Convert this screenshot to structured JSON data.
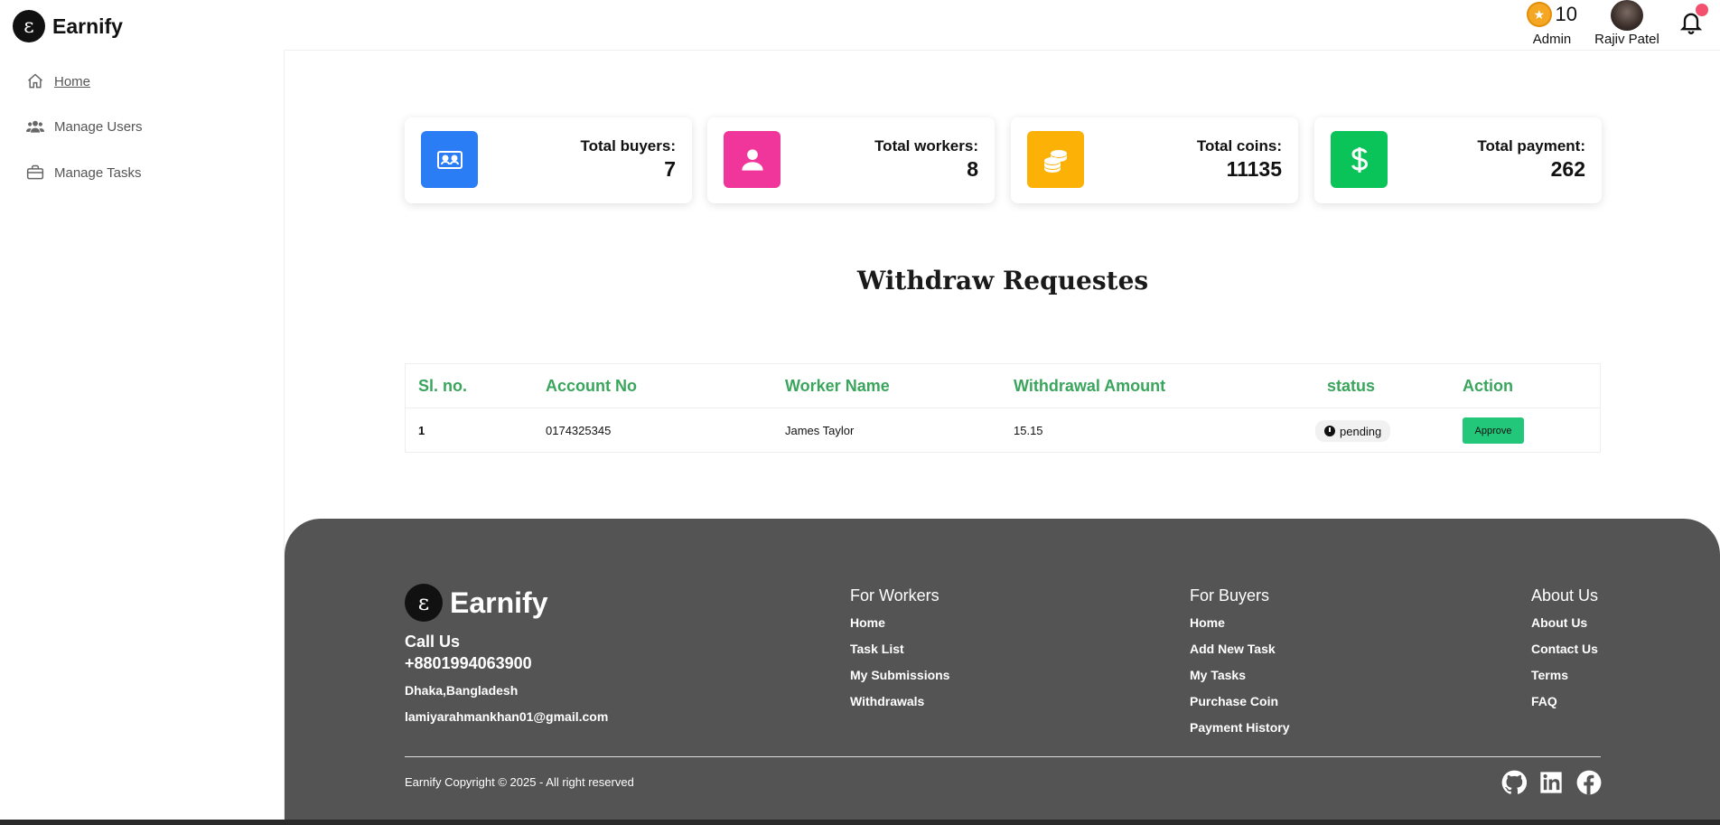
{
  "app": {
    "brand": "Earnify",
    "logo_glyph": "ɛ"
  },
  "header": {
    "coins": "10",
    "role": "Admin",
    "user_name": "Rajiv Patel",
    "notification_dot": true
  },
  "sidebar": {
    "items": [
      {
        "label": "Home",
        "icon": "home-icon",
        "active": true
      },
      {
        "label": "Manage Users",
        "icon": "users-icon",
        "active": false
      },
      {
        "label": "Manage Tasks",
        "icon": "briefcase-icon",
        "active": false
      }
    ]
  },
  "stats": [
    {
      "label": "Total buyers:",
      "value": "7",
      "icon": "id-card-icon",
      "color": "#2b7df6"
    },
    {
      "label": "Total workers:",
      "value": "8",
      "icon": "user-icon",
      "color": "#f0359b"
    },
    {
      "label": "Total coins:",
      "value": "11135",
      "icon": "coins-icon",
      "color": "#fbb105"
    },
    {
      "label": "Total payment:",
      "value": "262",
      "icon": "dollar-icon",
      "color": "#0ac459"
    }
  ],
  "withdraw": {
    "title": "Withdraw Requestes",
    "columns": [
      "Sl. no.",
      "Account No",
      "Worker Name",
      "Withdrawal Amount",
      "status",
      "Action"
    ],
    "rows": [
      {
        "sl": "1",
        "account": "0174325345",
        "worker": "James Taylor",
        "amount": "15.15",
        "status": "pending",
        "action": "Approve"
      }
    ]
  },
  "footer": {
    "brand": "Earnify",
    "call_us": "Call Us",
    "phone": "+8801994063900",
    "address": "Dhaka,Bangladesh",
    "email": "lamiyarahmankhan01@gmail.com",
    "workers": {
      "title": "For Workers",
      "links": [
        "Home",
        "Task List",
        "My Submissions",
        "Withdrawals"
      ]
    },
    "buyers": {
      "title": "For Buyers",
      "links": [
        "Home",
        "Add New Task",
        "My Tasks",
        "Purchase Coin",
        "Payment History"
      ]
    },
    "about": {
      "title": "About Us",
      "links": [
        "About Us",
        "Contact Us",
        "Terms",
        "FAQ"
      ]
    },
    "copyright": "Earnify  Copyright © 2025 - All right reserved",
    "social": [
      "github-icon",
      "linkedin-icon",
      "facebook-icon"
    ]
  },
  "colors": {
    "table_header": "#3aa55c",
    "approve": "#22c77a",
    "footer_bg": "#545454"
  }
}
